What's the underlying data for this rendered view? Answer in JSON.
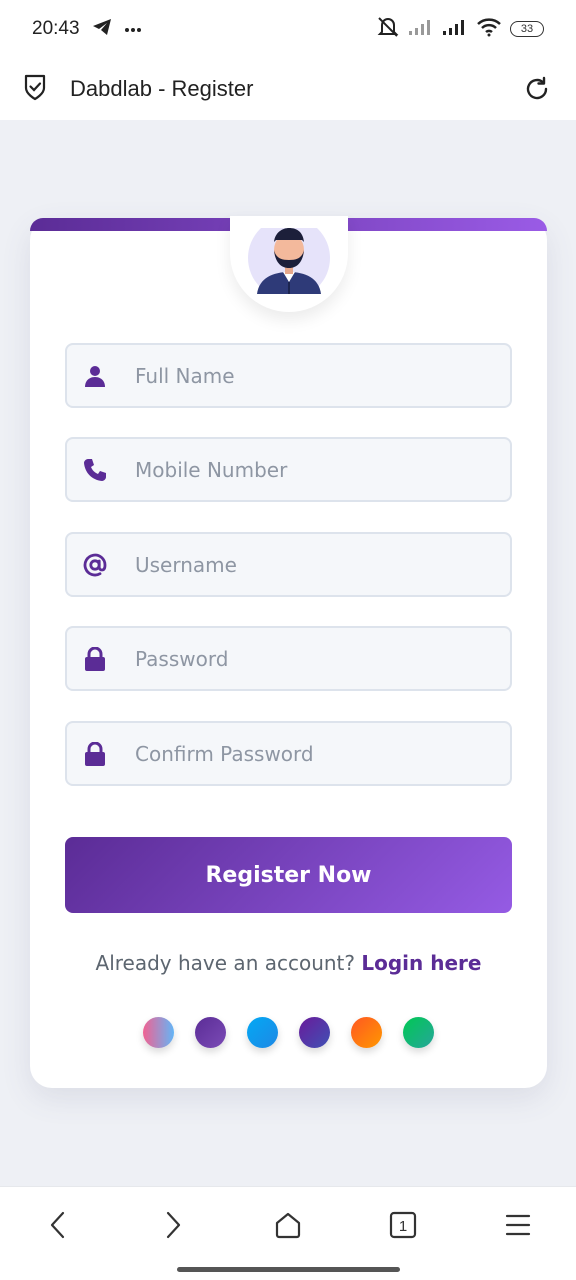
{
  "status_bar": {
    "time": "20:43",
    "battery": "33"
  },
  "app_bar": {
    "title": "Dabdlab - Register"
  },
  "form": {
    "full_name": {
      "placeholder": "Full Name",
      "value": ""
    },
    "mobile": {
      "placeholder": "Mobile Number",
      "value": ""
    },
    "username": {
      "placeholder": "Username",
      "value": ""
    },
    "password": {
      "placeholder": "Password",
      "value": ""
    },
    "confirm_password": {
      "placeholder": "Confirm Password",
      "value": ""
    },
    "submit_label": "Register Now"
  },
  "footer": {
    "prompt": "Already have an account?",
    "link": "Login here"
  },
  "theme_swatches": [
    {
      "name": "pink-blue",
      "colors": [
        "#f06292",
        "#64b5f6"
      ]
    },
    {
      "name": "purple",
      "colors": [
        "#5b2c96",
        "#7b4bb6"
      ]
    },
    {
      "name": "sky-blue",
      "colors": [
        "#03a9f4",
        "#1e88e5"
      ]
    },
    {
      "name": "indigo",
      "colors": [
        "#6a1b9a",
        "#3f51b5"
      ]
    },
    {
      "name": "orange",
      "colors": [
        "#ff5722",
        "#ff9800"
      ]
    },
    {
      "name": "green",
      "colors": [
        "#00c853",
        "#26a69a"
      ]
    }
  ],
  "bottom_nav": {
    "tabs_count": "1"
  },
  "colors": {
    "accent": "#5b2c96",
    "accent_light": "#955be4",
    "field_bg": "#f5f7fa"
  }
}
